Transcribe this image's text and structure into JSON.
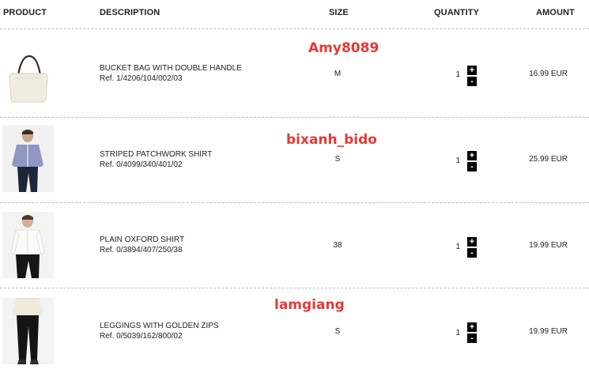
{
  "header": {
    "product": "PRODUCT",
    "description": "DESCRIPTION",
    "size": "SIZE",
    "quantity": "QUANTITY",
    "amount": "AMOUNT"
  },
  "items": [
    {
      "name": "BUCKET BAG WITH DOUBLE HANDLE",
      "ref": "Ref. 1/4206/104/002/03",
      "size": "M",
      "quantity": "1",
      "amount": "16.99 EUR",
      "watermark": "Amy8089",
      "image": "cream-bucket-bag"
    },
    {
      "name": "STRIPED PATCHWORK SHIRT",
      "ref": "Ref. 0/4099/340/401/02",
      "size": "S",
      "quantity": "1",
      "amount": "25.99 EUR",
      "watermark": "bixanh_bido",
      "image": "model-striped-shirt"
    },
    {
      "name": "PLAIN OXFORD SHIRT",
      "ref": "Ref. 0/3894/407/250/38",
      "size": "38",
      "quantity": "1",
      "amount": "19.99 EUR",
      "watermark": "",
      "image": "model-white-shirt"
    },
    {
      "name": "LEGGINGS WITH GOLDEN ZIPS",
      "ref": "Ref. 0/5039/162/800/02",
      "size": "S",
      "quantity": "1",
      "amount": "19.99 EUR",
      "watermark": "lamgiang",
      "image": "model-leggings"
    }
  ],
  "controls": {
    "plus": "+",
    "minus": "-"
  },
  "colors": {
    "watermark": "#e53935",
    "button": "#000000"
  }
}
